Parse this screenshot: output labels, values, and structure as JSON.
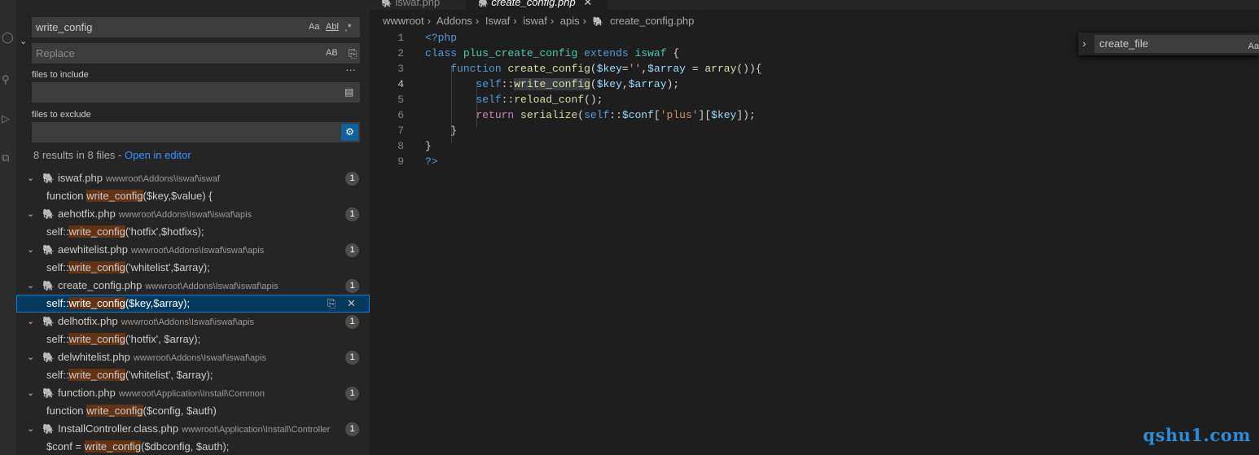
{
  "tabs": [
    {
      "label": "iswaf.php",
      "active": false
    },
    {
      "label": "create_config.php",
      "active": true
    }
  ],
  "breadcrumb": [
    "wwwroot",
    "Addons",
    "Iswaf",
    "iswaf",
    "apis",
    "create_config.php"
  ],
  "search": {
    "query": "write_config",
    "replace_placeholder": "Replace",
    "files_to_include_label": "files to include",
    "files_to_exclude_label": "files to exclude",
    "results_summary": "8 results in 8 files - ",
    "open_in_editor": "Open in editor",
    "match_case": "Aa",
    "whole_word": "Abl",
    "regex": ".*",
    "preserve_case": "AB"
  },
  "results": [
    {
      "file": "iswaf.php",
      "path": "wwwroot\\Addons\\Iswaf\\iswaf",
      "count": "1",
      "pre": "function ",
      "match": "write_config",
      "post": "($key,$value) {"
    },
    {
      "file": "aehotfix.php",
      "path": "wwwroot\\Addons\\Iswaf\\iswaf\\apis",
      "count": "1",
      "pre": "self::",
      "match": "write_config",
      "post": "('hotfix',$hotfixs);"
    },
    {
      "file": "aewhitelist.php",
      "path": "wwwroot\\Addons\\Iswaf\\iswaf\\apis",
      "count": "1",
      "pre": "self::",
      "match": "write_config",
      "post": "('whitelist',$array);"
    },
    {
      "file": "create_config.php",
      "path": "wwwroot\\Addons\\Iswaf\\iswaf\\apis",
      "count": "1",
      "pre": "self::",
      "match": "write_config",
      "post": "($key,$array);"
    },
    {
      "file": "delhotfix.php",
      "path": "wwwroot\\Addons\\Iswaf\\iswaf\\apis",
      "count": "1",
      "pre": "self::",
      "match": "write_config",
      "post": "('hotfix', $array);"
    },
    {
      "file": "delwhitelist.php",
      "path": "wwwroot\\Addons\\Iswaf\\iswaf\\apis",
      "count": "1",
      "pre": "self::",
      "match": "write_config",
      "post": "('whitelist', $array);"
    },
    {
      "file": "function.php",
      "path": "wwwroot\\Application\\Install\\Common",
      "count": "1",
      "pre": "function ",
      "match": "write_config",
      "post": "($config, $auth)"
    },
    {
      "file": "InstallController.class.php",
      "path": "wwwroot\\Application\\Install\\Controller",
      "count": "1",
      "pre": "$conf   =   ",
      "match": "write_config",
      "post": "($dbconfig, $auth);"
    }
  ],
  "editor": {
    "line_numbers": [
      "1",
      "2",
      "3",
      "4",
      "5",
      "6",
      "7",
      "8",
      "9"
    ],
    "find_widget_value": "create_file",
    "find_widget_option": "Aa"
  },
  "watermark": "qshu1.com",
  "colors": {
    "match_highlight": "#623315",
    "selection": "#04395e",
    "keyword": "#569cd6",
    "function": "#dcdcaa",
    "variable": "#9cdcfe",
    "string": "#ce9178"
  }
}
